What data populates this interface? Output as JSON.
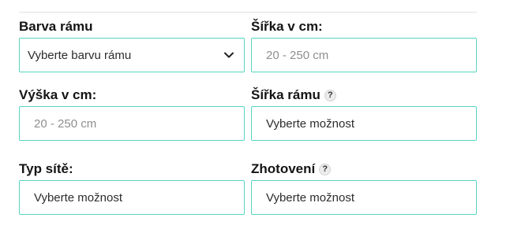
{
  "form": {
    "fields": [
      {
        "label": "Barva rámu",
        "value": "Vyberte barvu rámu",
        "type": "select"
      },
      {
        "label": "Šířka v cm:",
        "placeholder": "20 - 250 cm",
        "type": "input"
      },
      {
        "label": "Výška v cm:",
        "placeholder": "20 - 250 cm",
        "type": "input"
      },
      {
        "label": "Šířka rámu",
        "help_icon": "?",
        "value": "Vyberte možnost",
        "type": "option"
      },
      {
        "label": "Typ sítě:",
        "value": "Vyberte možnost",
        "type": "option"
      },
      {
        "label": "Zhotovení",
        "help_icon": "?",
        "value": "Vyberte možnost",
        "type": "option"
      }
    ]
  },
  "colors": {
    "accent_border": "#59d3c2",
    "label_text": "#141414",
    "placeholder_text": "#8e8e8e"
  },
  "icons": {
    "dropdown": "chevron-down-icon",
    "help": "help-icon"
  }
}
